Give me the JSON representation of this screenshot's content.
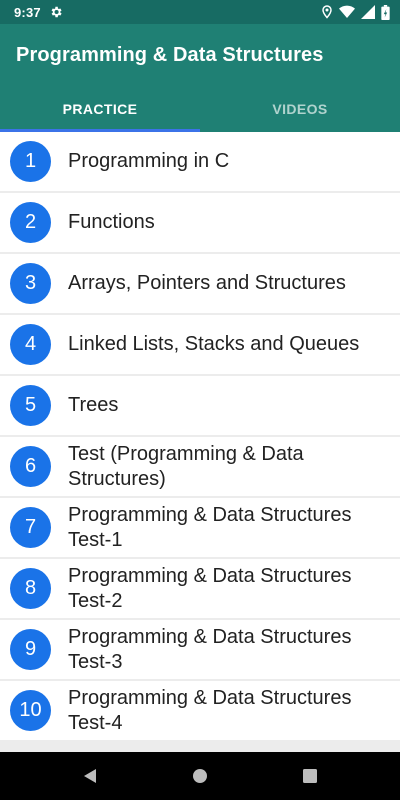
{
  "status_bar": {
    "time": "9:37",
    "icons": [
      "gear-icon",
      "location-icon",
      "wifi-icon",
      "signal-icon",
      "battery-icon"
    ]
  },
  "app_bar": {
    "title": "Programming & Data Structures",
    "background": "#1f8074"
  },
  "tabs": [
    {
      "label": "PRACTICE",
      "active": true
    },
    {
      "label": "VIDEOS",
      "active": false
    }
  ],
  "accent_color": "#1a73e8",
  "items": [
    {
      "number": "1",
      "label": "Programming in C"
    },
    {
      "number": "2",
      "label": "Functions"
    },
    {
      "number": "3",
      "label": "Arrays, Pointers and Structures"
    },
    {
      "number": "4",
      "label": "Linked Lists, Stacks and Queues"
    },
    {
      "number": "5",
      "label": "Trees"
    },
    {
      "number": "6",
      "label": "Test (Programming & Data Structures)"
    },
    {
      "number": "7",
      "label": "Programming & Data Structures Test-1"
    },
    {
      "number": "8",
      "label": "Programming & Data Structures Test-2"
    },
    {
      "number": "9",
      "label": "Programming & Data Structures Test-3"
    },
    {
      "number": "10",
      "label": "Programming & Data Structures Test-4"
    }
  ],
  "nav_bar": {
    "buttons": [
      "back-icon",
      "home-icon",
      "recents-icon"
    ]
  }
}
